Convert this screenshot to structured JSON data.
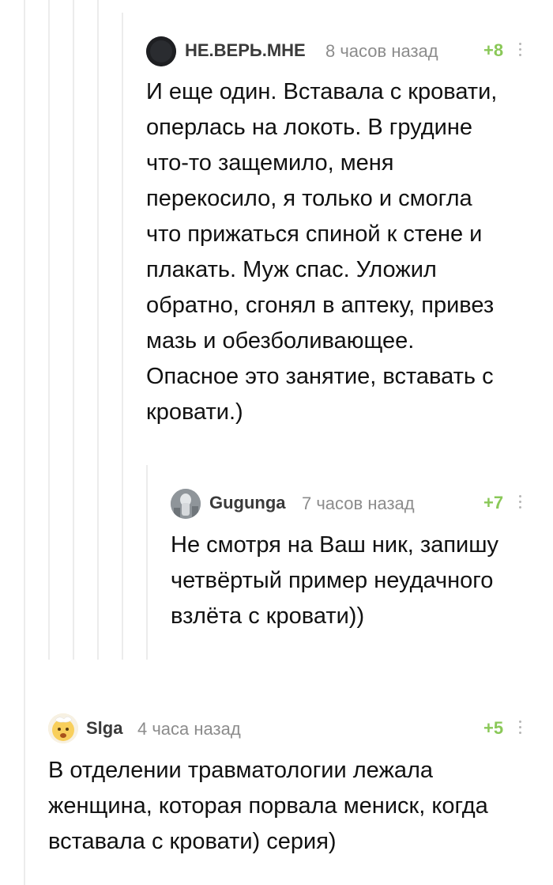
{
  "comments": [
    {
      "author": "НЕ.ВЕРЬ.МНЕ",
      "time": "8 часов назад",
      "rating": "+8",
      "avatar_icon": "avatar-dark-circle",
      "text_lines": [
        "И еще один. Вставала с кровати,",
        "оперлась на локоть. В грудине",
        "что-то защемило, меня",
        "перекосило, я только и смогла",
        "что прижаться спиной к стене и",
        "плакать. Муж спас. Уложил",
        "обратно, сгонял в аптеку, привез",
        "мазь и обезболивающее.",
        "Опасное это занятие, вставать с",
        "кровати.)"
      ]
    },
    {
      "author": "Gugunga",
      "time": "7 часов назад",
      "rating": "+7",
      "avatar_icon": "avatar-grey-photo",
      "text_lines": [
        "Не смотря на Ваш ник, запишу",
        "четвёртый пример неудачного",
        "взлёта с кровати))"
      ]
    },
    {
      "author": "Slga",
      "time": "4 часа назад",
      "rating": "+5",
      "avatar_icon": "avatar-yellow-emoji",
      "text_lines": [
        "В отделении травматологии лежала",
        "женщина, которая порвала мениск, когда",
        "вставала с кровати) серия)"
      ]
    }
  ],
  "colors": {
    "rating": "#8ac858",
    "thread_line": "#ececec",
    "author": "#3a3a3a",
    "time": "#8c8c8c"
  }
}
